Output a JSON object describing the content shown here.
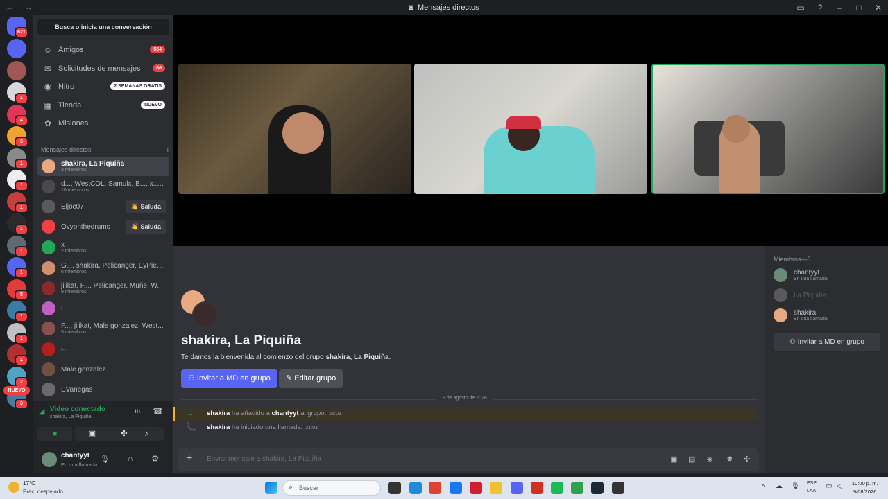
{
  "titlebar": {
    "title": "Mensajes directos",
    "nav": "← →"
  },
  "rail": {
    "home_badge": "621",
    "servers": [
      {
        "color": "#5865f2",
        "badge": ""
      },
      {
        "color": "#a15656",
        "badge": ""
      },
      {
        "color": "#d8d8d8",
        "badge": "1"
      },
      {
        "color": "#e0365a",
        "badge": "4"
      },
      {
        "color": "#f0a232",
        "badge": "3"
      },
      {
        "color": "#8a8a8a",
        "badge": "1"
      },
      {
        "color": "#eeeeee",
        "badge": "1"
      },
      {
        "color": "#c44040",
        "badge": "1"
      },
      {
        "color": "#2b2b2b",
        "badge": "1"
      },
      {
        "color": "#606a70",
        "badge": "1"
      },
      {
        "color": "#5865f2",
        "badge": "1"
      },
      {
        "color": "#e23b3b",
        "badge": "8"
      },
      {
        "color": "#3a7ca5",
        "badge": "1"
      },
      {
        "color": "#c0c0c0",
        "badge": "1"
      },
      {
        "color": "#b03030",
        "badge": "1"
      },
      {
        "color": "#4fa3c7",
        "badge": "2"
      },
      {
        "color": "#4a7aa0",
        "badge": "3"
      }
    ],
    "nuevo": "NUEVO"
  },
  "sidebar": {
    "search": "Busca o inicia una conversación",
    "nav": [
      {
        "label": "Amigos",
        "icon": "friends-icon",
        "glyph": "☺",
        "pill": "554",
        "pill_style": "red"
      },
      {
        "label": "Solicitudes de mensajes",
        "icon": "mail-icon",
        "glyph": "✉",
        "pill": "66",
        "pill_style": "red"
      },
      {
        "label": "Nitro",
        "icon": "nitro-icon",
        "glyph": "◉",
        "pill": "2 SEMANAS GRATIS",
        "pill_style": "white"
      },
      {
        "label": "Tienda",
        "icon": "shop-icon",
        "glyph": "▦",
        "pill": "NUEVO",
        "pill_style": "white"
      },
      {
        "label": "Misiones",
        "icon": "quests-icon",
        "glyph": "✿",
        "pill": "",
        "pill_style": ""
      }
    ],
    "dm_header": "Mensajes directos",
    "dm_add": "+",
    "dms": [
      {
        "name": "shakira, La Piquiña",
        "sub": "3 miembros",
        "color": "#e8a880",
        "active": true,
        "wave": ""
      },
      {
        "name": "d..., WestCOL, Samulx, B..., x..., ...",
        "sub": "10 miembros",
        "color": "#4a4a4a",
        "active": false,
        "wave": ""
      },
      {
        "name": "Eljoc07",
        "sub": "",
        "color": "#5a5a5a",
        "active": false,
        "wave": "👋 Saluda"
      },
      {
        "name": "Ovyonthedrums",
        "sub": "",
        "color": "#f23f43",
        "active": false,
        "wave": "👋 Saluda"
      },
      {
        "name": "x",
        "sub": "2 miembros",
        "color": "#23a55a",
        "active": false,
        "wave": ""
      },
      {
        "name": "G..., shakira, Pelicanger, EyPied...",
        "sub": "6 miembros",
        "color": "#d09070",
        "active": false,
        "wave": ""
      },
      {
        "name": "jilikat, F..., Pelicanger, Muñe, W...",
        "sub": "9 miembros",
        "color": "#8a2a2a",
        "active": false,
        "wave": ""
      },
      {
        "name": "E...",
        "sub": "",
        "color": "#c060c0",
        "active": false,
        "wave": ""
      },
      {
        "name": "F..., jilikat, Male gonzalez, West...",
        "sub": "5 miembros",
        "color": "#8a5050",
        "active": false,
        "wave": ""
      },
      {
        "name": "F...",
        "sub": "",
        "color": "#b02020",
        "active": false,
        "wave": ""
      },
      {
        "name": "Male gonzalez",
        "sub": "",
        "color": "#705040",
        "active": false,
        "wave": ""
      },
      {
        "name": "EVanegas",
        "sub": "",
        "color": "#6a6a6a",
        "active": false,
        "wave": ""
      }
    ]
  },
  "voice": {
    "status": "Video conectado",
    "channel": "shakira, La Piquiña"
  },
  "user": {
    "name": "chantyyt",
    "status": "En una llamada"
  },
  "group": {
    "title": "shakira, La Piquiña",
    "welcome_prefix": "Te damos la bienvenida al comienzo del grupo ",
    "welcome_name": "shakira, La Piquiña",
    "welcome_suffix": ".",
    "invite_btn": "Invitar a MD en grupo",
    "edit_btn": "Editar grupo"
  },
  "messages": {
    "date": "9 de agosto de 2026",
    "items": [
      {
        "actor": "shakira",
        "action": " ha añadido a ",
        "target": "chantyyt",
        "rest": " al grupo.",
        "time": "21:03",
        "icon": "→"
      },
      {
        "actor": "shakira",
        "action": " ha iniciado una llamada.",
        "target": "",
        "rest": "",
        "time": "21:03",
        "icon": "📞"
      }
    ],
    "placeholder": "Enviar mensaje a shakira, La Piquiña"
  },
  "members": {
    "header": "Miembros—3",
    "list": [
      {
        "name": "chantyyt",
        "status": "En una llamada",
        "color": "#6a8a7a"
      },
      {
        "name": "La Piquiña",
        "status": "",
        "color": "#5a5a5a"
      },
      {
        "name": "shakira",
        "status": "En una llamada",
        "color": "#e8a880"
      }
    ],
    "invite_btn": "Invitar a MD en grupo"
  },
  "taskbar": {
    "temp": "17°C",
    "weather": "Prac. despejado",
    "search": "Buscar",
    "lang1": "ESP",
    "lang2": "LAA",
    "time": "10:00 p. m.",
    "date": "9/08/2026"
  },
  "colors": {
    "accent": "#5865f2",
    "green": "#23a55a",
    "red": "#f23f43"
  }
}
